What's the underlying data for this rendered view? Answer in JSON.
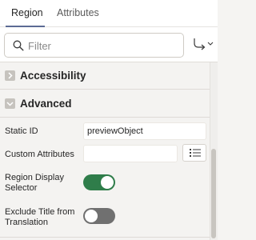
{
  "tabs": [
    {
      "label": "Region",
      "active": true
    },
    {
      "label": "Attributes",
      "active": false
    }
  ],
  "filter": {
    "placeholder": "Filter",
    "value": ""
  },
  "sections": [
    {
      "title": "Accessibility",
      "expanded": false
    },
    {
      "title": "Advanced",
      "expanded": true
    }
  ],
  "fields": {
    "static_id": {
      "label": "Static ID",
      "value": "previewObject"
    },
    "custom_attributes": {
      "label": "Custom Attributes",
      "value": ""
    },
    "region_display_selector": {
      "label_line1": "Region Display",
      "label_line2": "Selector",
      "on": true
    },
    "exclude_title": {
      "label_line1": "Exclude Title from",
      "label_line2": "Translation",
      "on": false
    }
  },
  "colors": {
    "accent": "#5b6a94",
    "toggle_on": "#2f7d4a",
    "toggle_off": "#707070",
    "chevron_box": "#c6c3be"
  },
  "icons": {
    "search": "search-icon",
    "goto": "goto-arrow-icon",
    "expand": "chevron-right-icon",
    "collapse": "chevron-down-icon",
    "list": "list-icon"
  }
}
